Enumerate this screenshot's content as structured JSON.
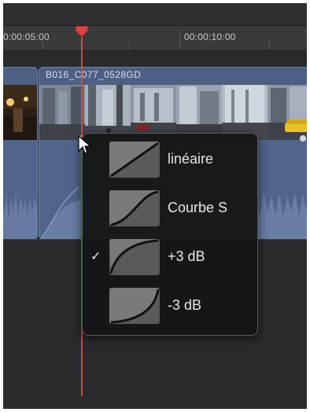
{
  "timeline": {
    "timecode_left": "0:00:05:00",
    "timecode_right": "00:00:10:00",
    "clip_name": "B016_C077_0528GD"
  },
  "fade_menu": {
    "items": [
      {
        "label": "linéaire",
        "icon": "linear-curve-icon",
        "checked": false
      },
      {
        "label": "Courbe S",
        "icon": "s-curve-icon",
        "checked": false
      },
      {
        "label": "+3 dB",
        "icon": "plus-3db-curve-icon",
        "checked": true
      },
      {
        "label": "-3 dB",
        "icon": "minus-3db-curve-icon",
        "checked": false
      }
    ],
    "checkmark": "✓"
  },
  "colors": {
    "playhead": "#e24848",
    "clip_blue": "#4d5f82"
  }
}
